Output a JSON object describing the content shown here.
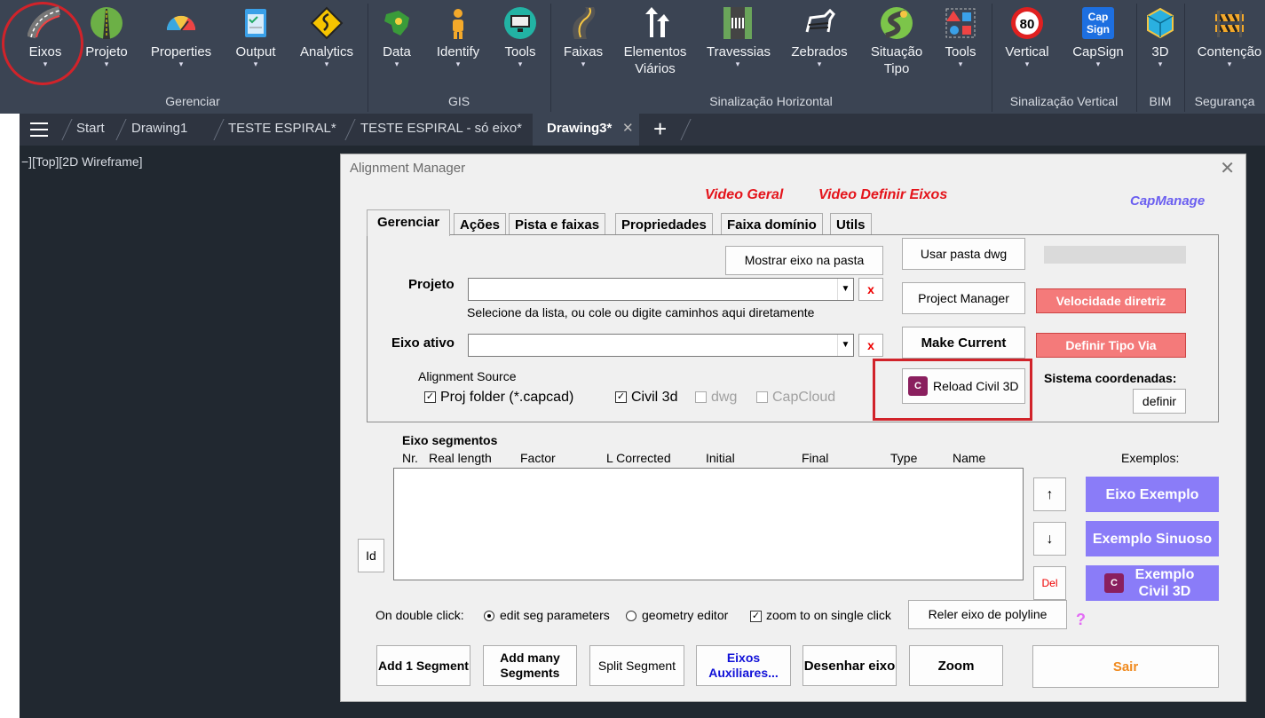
{
  "ribbon": {
    "buttons": [
      {
        "label": "Eixos",
        "icon": "road-curve-icon"
      },
      {
        "label": "Projeto",
        "icon": "road-straight-icon"
      },
      {
        "label": "Properties",
        "icon": "gauge-icon"
      },
      {
        "label": "Output",
        "icon": "clipboard-check-icon"
      },
      {
        "label": "Analytics",
        "icon": "sign-curve-icon"
      },
      {
        "label": "Data",
        "icon": "brazil-map-icon"
      },
      {
        "label": "Identify",
        "icon": "person-icon"
      },
      {
        "label": "Tools",
        "icon": "monitor-tools-icon"
      },
      {
        "label": "Faixas",
        "icon": "lanes-icon"
      },
      {
        "label": "Elementos",
        "label2": "Viários",
        "icon": "arrows-icon"
      },
      {
        "label": "Travessias",
        "icon": "crossing-icon"
      },
      {
        "label": "Zebrados",
        "icon": "zebra-icon"
      },
      {
        "label": "Situação",
        "label2": "Tipo",
        "icon": "winding-road-icon"
      },
      {
        "label": "Tools",
        "icon": "shapes-icon"
      },
      {
        "label": "Vertical",
        "icon": "speed-80-icon"
      },
      {
        "label": "CapSign",
        "icon": "capsign-icon"
      },
      {
        "label": "3D",
        "icon": "cube-icon"
      },
      {
        "label": "Contenção",
        "icon": "barrier-icon"
      }
    ],
    "groups": [
      "Gerenciar",
      "GIS",
      "Sinalização Horizontal",
      "Sinalização Vertical",
      "BIM",
      "Segurança"
    ],
    "speed_sign": "80",
    "capsign_text": "Cap Sign"
  },
  "file_tabs": [
    "Start",
    "Drawing1",
    "TESTE ESPIRAL*",
    "TESTE ESPIRAL - só eixo*",
    "Drawing3*"
  ],
  "viewport_label": "−][Top][2D Wireframe]",
  "dialog": {
    "title": "Alignment Manager",
    "close": "✕",
    "link_video_geral": "Video Geral",
    "link_video_eixos": "Video Definir Eixos",
    "capmanage": "CapManage",
    "tabs": [
      "Gerenciar",
      "Ações",
      "Pista e faixas",
      "Propriedades",
      "Faixa domínio",
      "Utils"
    ],
    "mostrar_eixo": "Mostrar eixo na pasta",
    "projeto_label": "Projeto",
    "projeto_hint": "Selecione da lista, ou cole ou digite caminhos aqui diretamente",
    "eixo_ativo_label": "Eixo ativo",
    "x_label": "x",
    "alignment_source": "Alignment Source",
    "src_proj": "Proj folder (*.capcad)",
    "src_civil": "Civil 3d",
    "src_dwg": "dwg",
    "src_capcloud": "CapCloud",
    "usar_pasta": "Usar pasta dwg",
    "project_manager": "Project Manager",
    "make_current": "Make Current",
    "reload_civil": "Reload Civil 3D",
    "velocidade": "Velocidade diretriz",
    "definir_tipo": "Definir Tipo Via",
    "sistema_coord": "Sistema coordenadas:",
    "definir": "definir",
    "eixo_segmentos": "Eixo segmentos",
    "columns": [
      "Nr.",
      "Real length",
      "Factor",
      "L Corrected",
      "Initial",
      "Final",
      "Type",
      "Name"
    ],
    "id_btn": "Id",
    "up": "↑",
    "down": "↓",
    "del": "Del",
    "exemplos": "Exemplos:",
    "ex1": "Eixo Exemplo",
    "ex2": "Exemplo Sinuoso",
    "ex3": "Exemplo Civil 3D",
    "c3d_icon": "C",
    "on_double": "On double click:",
    "opt_edit": "edit seg parameters",
    "opt_geom": "geometry editor",
    "zoom_single": "zoom to on single click",
    "reler": "Reler eixo de polyline",
    "question": "?",
    "add1": "Add 1 Segment",
    "addmany": "Add many Segments",
    "split": "Split Segment",
    "aux": "Eixos Auxiliares...",
    "desenhar": "Desenhar eixo",
    "zoom": "Zoom",
    "sair": "Sair"
  }
}
